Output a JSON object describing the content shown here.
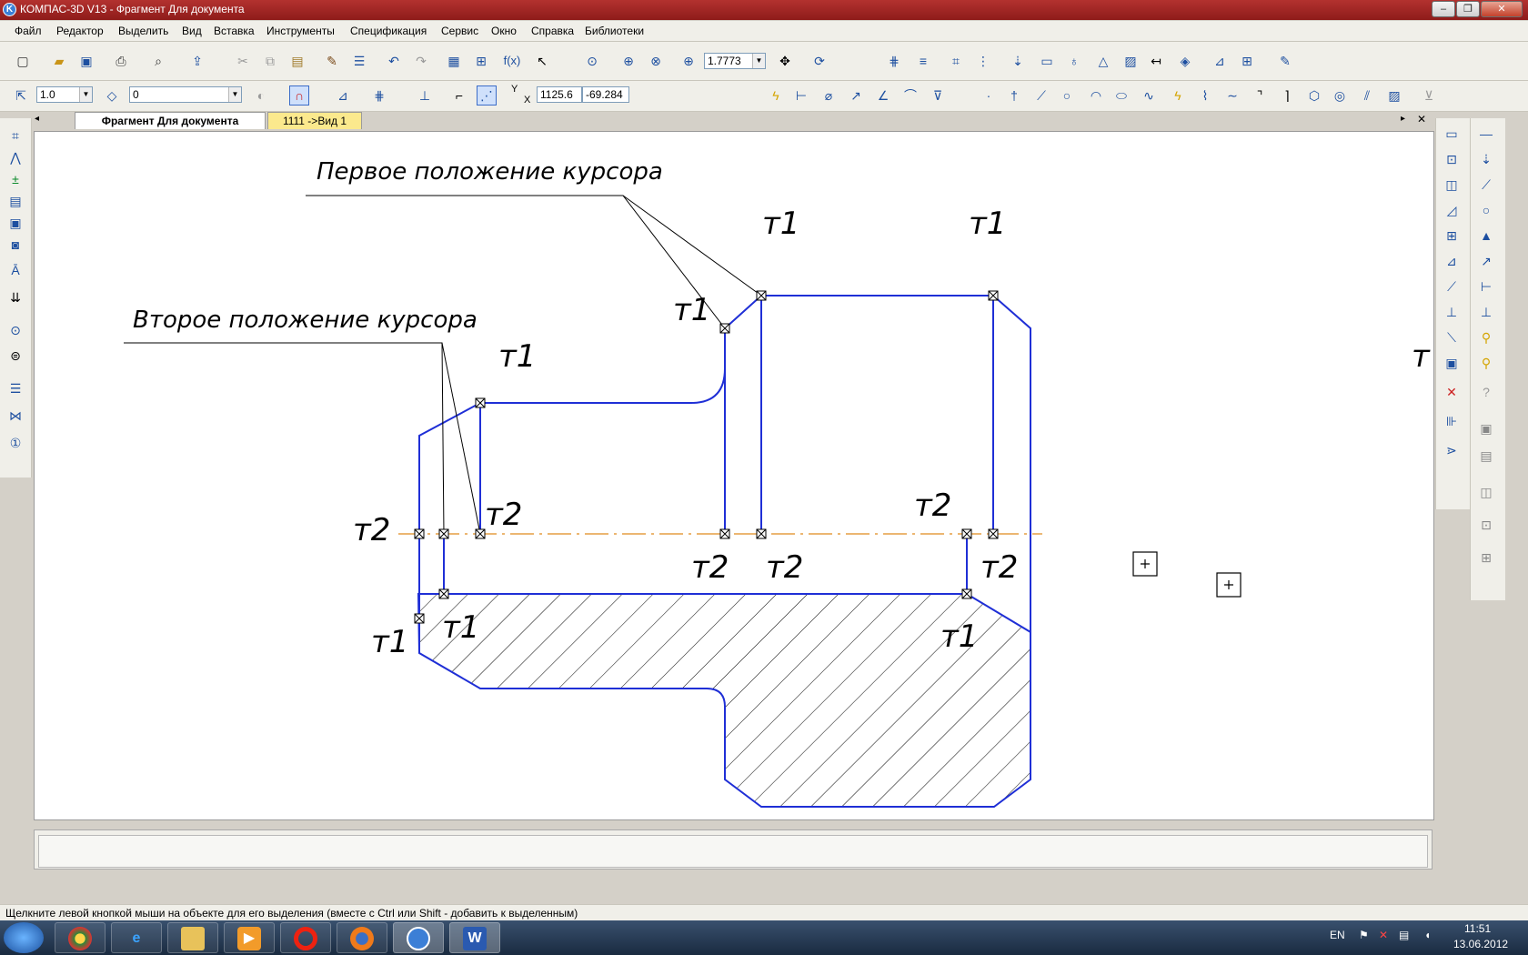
{
  "window": {
    "title": "КОМПАС-3D V13 - Фрагмент Для документа",
    "app_icon_glyph": "K",
    "minimize_glyph": "–",
    "restore_glyph": "❐",
    "close_glyph": "✕"
  },
  "menu": [
    {
      "label": "Файл"
    },
    {
      "label": "Редактор"
    },
    {
      "label": "Выделить"
    },
    {
      "label": "Вид"
    },
    {
      "label": "Вставка"
    },
    {
      "label": "Инструменты"
    },
    {
      "label": "Спецификация"
    },
    {
      "label": "Сервис"
    },
    {
      "label": "Окно"
    },
    {
      "label": "Справка"
    },
    {
      "label": "Библиотеки"
    }
  ],
  "toolbar": {
    "zoom_value": "1.7773",
    "fx_label": "f(x)",
    "step_value": "1.0",
    "layer_value": "0",
    "coord_y_label": "Y",
    "coord_x_label": "X",
    "coord_y_value": "1125.6",
    "coord_x_value": "-69.284"
  },
  "tabs": [
    {
      "label": "Фрагмент Для документа",
      "active": true
    },
    {
      "label": "1111 ->Вид 1",
      "active": false
    }
  ],
  "drawing": {
    "annotation_first": "Первое положение курсора",
    "annotation_second": "Второе положение курсора",
    "label_t1": "т1",
    "label_t2": "т2",
    "edge_label": "т"
  },
  "status": {
    "hint": "Щелкните левой кнопкой мыши на объекте для его выделения (вместе с Ctrl или Shift - добавить к выделенным)"
  },
  "taskbar": {
    "language": "EN",
    "time": "11:51",
    "date": "13.06.2012"
  },
  "colors": {
    "geometry": "#1f2fd6",
    "axis": "#e08a1e",
    "title_bar": "#9e2523"
  }
}
